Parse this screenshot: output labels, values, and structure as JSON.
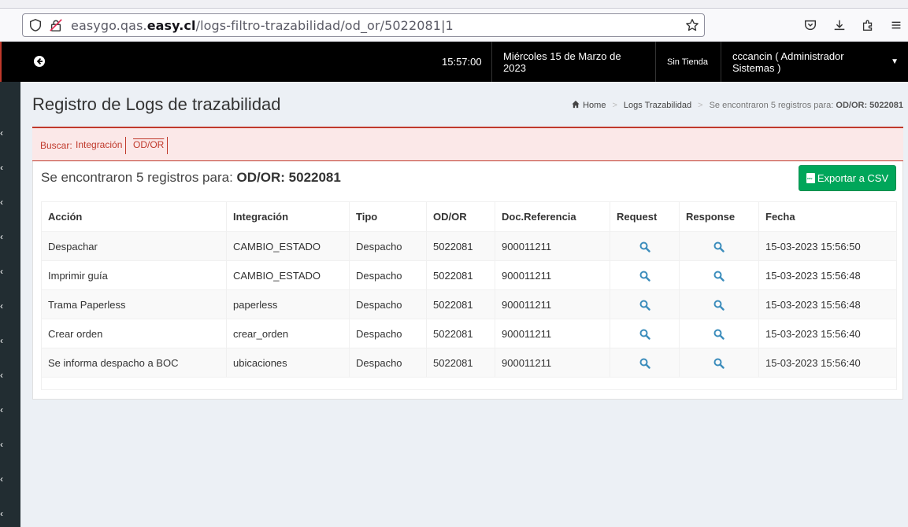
{
  "browser": {
    "url_prefix": "easygo.qas.",
    "url_domain": "easy.cl",
    "url_path": "/logs-filtro-trazabilidad/od_or/5022081|1"
  },
  "header": {
    "time": "15:57:00",
    "date": "Miércoles 15 de Marzo de 2023",
    "store": "Sin Tienda",
    "user": "cccancin ( Administrador Sistemas )"
  },
  "page": {
    "title": "Registro de Logs de trazabilidad"
  },
  "breadcrumb": {
    "home": "Home",
    "logs": "Logs Trazabilidad",
    "current_prefix": "Se encontraron 5 registros para:",
    "current_bold": "OD/OR: 5022081"
  },
  "filter": {
    "label": "Buscar:",
    "tags": [
      "Integración",
      "OD/OR"
    ]
  },
  "results": {
    "prefix": "Se encontraron 5 registros para:",
    "bold": "OD/OR: 5022081"
  },
  "export_button": "Exportar a CSV",
  "table": {
    "headers": [
      "Acción",
      "Integración",
      "Tipo",
      "OD/OR",
      "Doc.Referencia",
      "Request",
      "Response",
      "Fecha"
    ],
    "rows": [
      [
        "Despachar",
        "CAMBIO_ESTADO",
        "Despacho",
        "5022081",
        "900011211",
        "15-03-2023 15:56:50"
      ],
      [
        "Imprimir guía",
        "CAMBIO_ESTADO",
        "Despacho",
        "5022081",
        "900011211",
        "15-03-2023 15:56:48"
      ],
      [
        "Trama Paperless",
        "paperless",
        "Despacho",
        "5022081",
        "900011211",
        "15-03-2023 15:56:48"
      ],
      [
        "Crear orden",
        "crear_orden",
        "Despacho",
        "5022081",
        "900011211",
        "15-03-2023 15:56:40"
      ],
      [
        "Se informa despacho a BOC",
        "ubicaciones",
        "Despacho",
        "5022081",
        "900011211",
        "15-03-2023 15:56:40"
      ]
    ]
  },
  "colors": {
    "header_bg": "#000000",
    "sidebar_bg": "#222d32",
    "accent_red": "#c0392b",
    "export_green": "#00a65a",
    "link_blue": "#3c8dbc"
  }
}
